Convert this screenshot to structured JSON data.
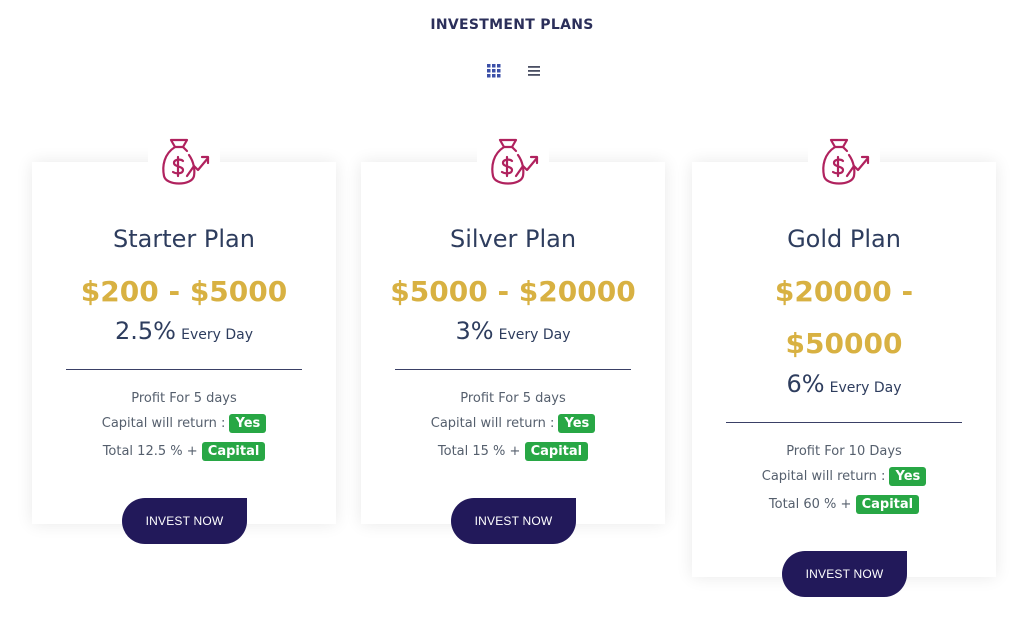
{
  "header": {
    "title": "INVESTMENT PLANS",
    "view_toggle": {
      "grid_icon": "grid-icon",
      "list_icon": "list-icon",
      "active": "grid"
    }
  },
  "colors": {
    "accent_navy": "#22195a",
    "price_gold": "#d8b142",
    "badge_green": "#28a745",
    "icon_magenta": "#b0225e"
  },
  "plans": [
    {
      "icon": "money-bag-growth-icon",
      "name": "Starter Plan",
      "range": "$200 - $5000",
      "rate": "2.5%",
      "rate_suffix": "Every Day",
      "profit_text": "Profit For 5 days",
      "capital_label": "Capital will return :",
      "capital_badge": "Yes",
      "total_label": "Total 12.5 % +",
      "total_badge": "Capital",
      "button_label": "INVEST NOW"
    },
    {
      "icon": "money-bag-growth-icon",
      "name": "Silver Plan",
      "range": "$5000 - $20000",
      "rate": "3%",
      "rate_suffix": "Every Day",
      "profit_text": "Profit For 5 days",
      "capital_label": "Capital will return :",
      "capital_badge": "Yes",
      "total_label": "Total 15 % +",
      "total_badge": "Capital",
      "button_label": "INVEST NOW"
    },
    {
      "icon": "money-bag-growth-icon",
      "name": "Gold Plan",
      "range": "$20000 - $50000",
      "rate": "6%",
      "rate_suffix": "Every Day",
      "profit_text": "Profit For 10 Days",
      "capital_label": "Capital will return :",
      "capital_badge": "Yes",
      "total_label": "Total 60 % +",
      "total_badge": "Capital",
      "button_label": "INVEST NOW"
    }
  ]
}
